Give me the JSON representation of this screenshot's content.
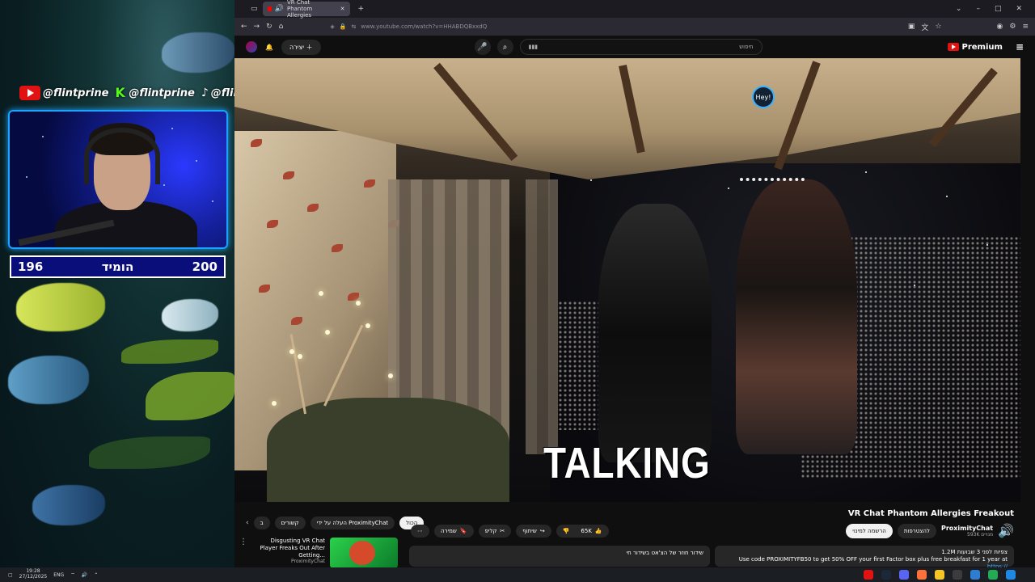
{
  "overlay": {
    "socials": [
      {
        "platform": "youtube-icon",
        "handle": "@flintprine"
      },
      {
        "platform": "kick-icon",
        "handle": "@flintprine"
      },
      {
        "platform": "tiktok-icon",
        "handle": "@flintprine"
      }
    ],
    "counter": {
      "left_value": "196",
      "label": "הומיד",
      "right_value": "200"
    }
  },
  "browser": {
    "tab_title": "VR Chat Phantom Allergies",
    "url": "www.youtube.com/watch?v=HHABDQBxxdQ"
  },
  "youtube": {
    "create_label": "יצירה",
    "search_placeholder": "חיפוש",
    "search_value": "▮▮▮",
    "premium_label": "Premium",
    "video_caption": "TALKING",
    "overlay_badge": "Hey!",
    "video_title": "VR Chat Phantom Allergies Freakout",
    "channel_name": "ProximityChat",
    "channel_subs": "593K מנויים",
    "subscribe_label": "הרשמה למינוי",
    "join_label": "להצטרפות",
    "likes": "65K",
    "share_label": "שיתוף",
    "clip_label": "קליפ",
    "save_label": "שמירה",
    "chips": [
      "הכול",
      "העלה על ידי ProximityChat",
      "קשורים",
      "ב"
    ],
    "recommendation": {
      "title": "Disgusting VR Chat Player Freaks Out After Getting...",
      "channel": "ProximityChat"
    },
    "desc_mid": "שידור חוזר של הצ'אט בשידור חי",
    "desc_stats": "1.2M צפיות  לפני 3 שבועות",
    "desc_text": "Use code PROXIMITYFB50 to get 50% OFF your first Factor box plus free breakfast for 1 year at",
    "desc_link": "https://"
  },
  "taskbar": {
    "time": "19:28",
    "date": "27/12/2025",
    "lang": "ENG"
  },
  "colors": {
    "youtube_red": "#e31212",
    "kick_green": "#53fc18",
    "counter_bg": "#0a0e7a",
    "webcam_border": "#1aa4ff"
  }
}
